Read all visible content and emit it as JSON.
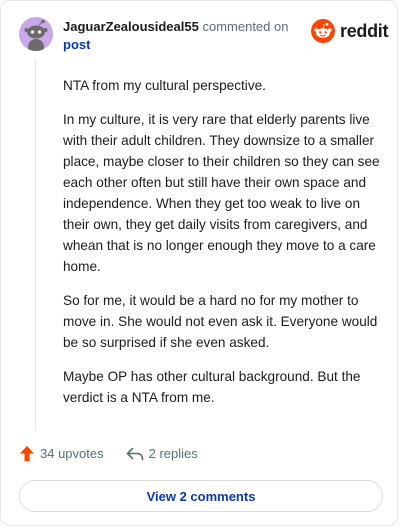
{
  "comment": {
    "username": "JaguarZealousideal55",
    "action_text": "commented on",
    "post_link": "post",
    "paragraphs": [
      "NTA from my cultural perspective.",
      "In my culture, it is very rare that elderly parents live with their adult children. They downsize to a smaller place, maybe closer to their children so they can see each other often but still have their own space and independence. When they get too weak to live on their own, they get daily visits from caregivers, and whean that is no longer enough they move to a care home.",
      "So for me, it would be a hard no for my mother to move in. She would not even ask it. Everyone would be so surprised if she even asked.",
      "Maybe OP has other cultural background. But the verdict is a NTA from me."
    ],
    "upvotes_label": "34 upvotes",
    "replies_label": "2 replies",
    "view_comments_label": "View 2 comments"
  },
  "brand": {
    "name": "reddit",
    "logo_icon": "reddit-snoo-icon",
    "accent_color": "#ff4500"
  },
  "icons": {
    "avatar": "snoo-avatar-icon",
    "upvote": "upvote-arrow-icon",
    "reply": "reply-arrow-icon"
  },
  "colors": {
    "upvote": "#ff4500",
    "link": "#0a3aa8",
    "muted": "#576f76"
  }
}
